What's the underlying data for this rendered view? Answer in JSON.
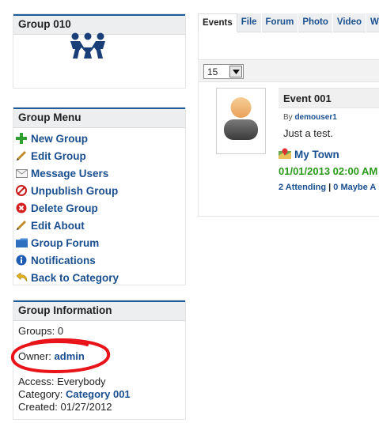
{
  "group": {
    "title": "Group 010",
    "logo": "group-people-icon"
  },
  "menu": {
    "title": "Group Menu",
    "items": [
      {
        "label": "New Group",
        "icon": "plus-icon"
      },
      {
        "label": "Edit Group",
        "icon": "pencil-icon"
      },
      {
        "label": "Message Users",
        "icon": "envelope-icon"
      },
      {
        "label": "Unpublish Group",
        "icon": "prohibited-icon"
      },
      {
        "label": "Delete Group",
        "icon": "delete-icon"
      },
      {
        "label": "Edit About",
        "icon": "pencil-icon"
      },
      {
        "label": "Group Forum",
        "icon": "folder-icon"
      },
      {
        "label": "Notifications",
        "icon": "info-icon"
      },
      {
        "label": "Back to Category",
        "icon": "undo-arrow-icon"
      }
    ]
  },
  "info": {
    "title": "Group Information",
    "groups": "Groups: 0",
    "owner_label": "Owner:",
    "owner_value": "admin",
    "access": "Access: Everybody",
    "category_label": "Category:",
    "category_value": "Category 001",
    "created": "Created: 01/27/2012"
  },
  "tabs": [
    "Events",
    "File",
    "Forum",
    "Photo",
    "Video",
    "W"
  ],
  "list_limit": "15",
  "event": {
    "title": "Event 001",
    "by_label": "By",
    "by_user": "demouser1",
    "description": "Just a test.",
    "location": "My Town",
    "datetime": "01/01/2013 02:00 AM",
    "attending": "2 Attending",
    "rsvp_separator": "|",
    "maybe": "0 Maybe A"
  },
  "colors": {
    "link": "#1a4f8f",
    "header_bar": "#1e5b99",
    "date_green": "#2a9a1a",
    "annotation_red": "#e8141a"
  }
}
